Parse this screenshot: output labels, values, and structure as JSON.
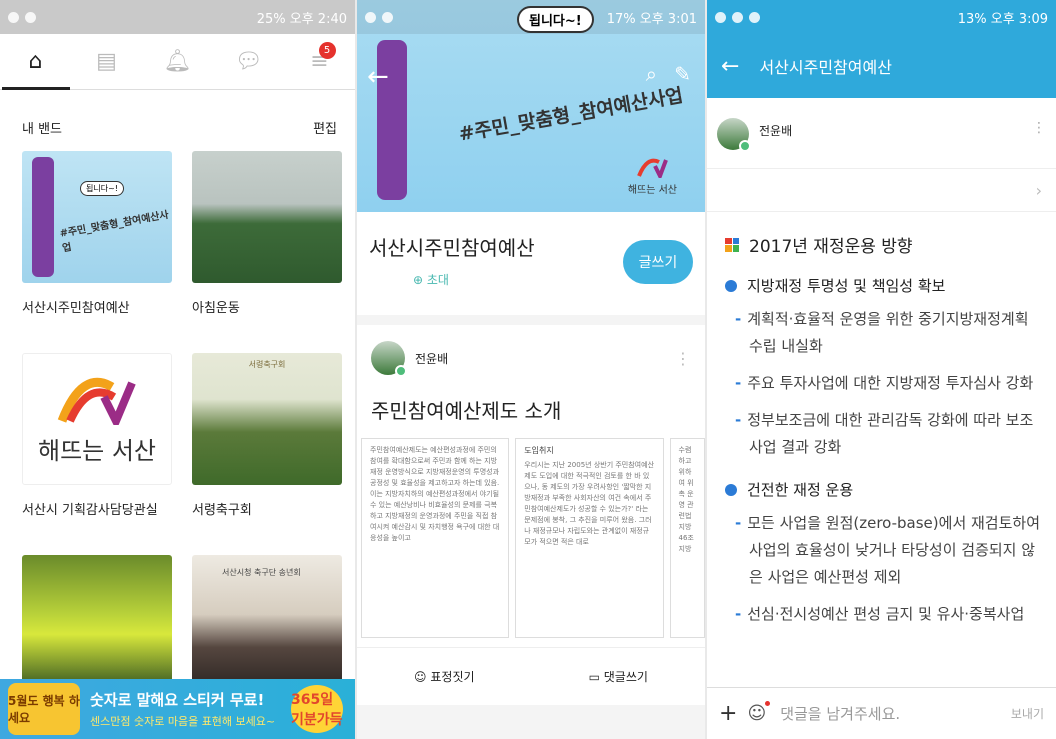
{
  "panel1": {
    "status": {
      "battery": "25%",
      "time": "오후 2:40"
    },
    "tabs": [
      {
        "icon": "home-icon",
        "glyph": "⌂"
      },
      {
        "icon": "calendar-icon",
        "glyph": "▤"
      },
      {
        "icon": "bell-icon",
        "glyph": "▲"
      },
      {
        "icon": "chat-icon",
        "glyph": "●"
      },
      {
        "icon": "menu-icon",
        "glyph": "≡",
        "badge": "5"
      }
    ],
    "section_title": "내 밴드",
    "edit_label": "편집",
    "bands": [
      {
        "name": "서산시주민참여예산"
      },
      {
        "name": "아침운동"
      },
      {
        "name": "서산시 기획감사담당관실",
        "logo_text": "해뜨는 서산"
      },
      {
        "name": "서령축구회"
      },
      {
        "name": ""
      },
      {
        "name": ""
      }
    ],
    "thumb_text": {
      "bubble": "됩니다~!",
      "hash": "#주민_맞춤형_참여예산사업",
      "club": "서령축구회",
      "club2": "서산시청 축구단 송년회"
    },
    "banner": {
      "left": "5월도 행복 하세요",
      "main": "숫자로 말해요 스티커 무료!",
      "sub": "센스만점 숫자로 마음을 표현해 보세요~",
      "right": "365일 기분가득"
    }
  },
  "panel2": {
    "status": {
      "battery": "17%",
      "time": "오후 3:01"
    },
    "cover_bubble": "됩니다~!",
    "cover_hash": "#주민_맞춤형_참여예산사업",
    "cover_logo": "해뜨는 서산",
    "band_title": "서산시주민참여예산",
    "invite": "⊕ 초대",
    "write_button": "글쓰기",
    "author": "전윤배",
    "post_title": "주민참여예산제도 소개",
    "doc1_text": "주민참여예산제도는 예산편성과정에 주민의 참여를 확대함으로써 주민과 함께 하는 지방재정 운영방식으로 지방재정운영의 투명성과 공정성 및 효율성을 제고하고자 하는데 있음. 이는 지방자치하의 예산편성과정에서 야기될 수 있는 예산낭비나 비효율성의 문제를 극복하고 지방재정의 운영과정에 주민을 직접 참여시켜 예산감시 및 자치행정 욕구에 대한 대응성을 높이고",
    "doc2_head": "도입취지",
    "doc2_text": "우리시는 지난 2005년 상반기 주민참여예산제도 도입에 대한 적극적인 검토를 한 바 있으나, 동 제도의 가장 우려사항인 '짧막한 지방재정과 부족한 사회자산의 여건 속에서 주민참여예산제도가 성공할 수 있는가?' 라는 문제점에 봉착, 그 추진을 미루어 왔음. 그러나 재정규모나 자립도와는 관계없이 재정규모가 적으면 적은 대로",
    "doc3_text": "수렴하고 위하여 위촉 운영 관련법 지방 46조 지방",
    "actions": {
      "emoji": "표정짓기",
      "comment": "댓글쓰기"
    }
  },
  "panel3": {
    "status": {
      "battery": "13%",
      "time": "오후 3:09"
    },
    "title": "서산시주민참여예산",
    "author": "전윤배",
    "heading": "2017년 재정운용 방향",
    "sections": [
      {
        "title": "지방재정 투명성 및 책임성 확보",
        "bullets": [
          "계획적·효율적 운영을 위한 중기지방재정계획 수립 내실화",
          "주요 투자사업에 대한 지방재정 투자심사 강화",
          "정부보조금에 대한 관리감독 강화에 따라 보조사업 결과 강화"
        ]
      },
      {
        "title": "건전한 재정 운용",
        "bullets": [
          "모든 사업을 원점(zero-base)에서 재검토하여 사업의 효율성이 낮거나 타당성이 검증되지 않은 사업은 예산편성 제외",
          "선심·전시성예산 편성 금지 및 유사·중복사업"
        ]
      }
    ],
    "comment_placeholder": "댓글을 남겨주세요.",
    "send_label": "보내기"
  }
}
